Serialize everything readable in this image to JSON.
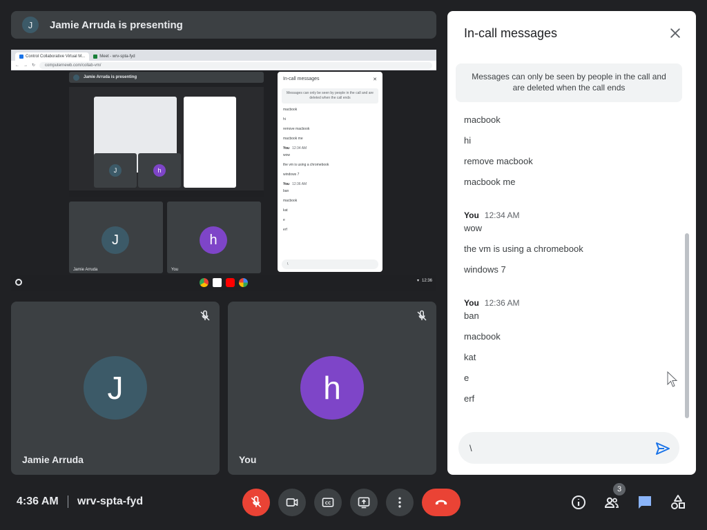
{
  "presenting": {
    "initial": "J",
    "text": "Jamie Arruda is presenting"
  },
  "screen": {
    "tab1": "Control Collaborative Virtual M...",
    "tab2": "Meet - wrv-spta-fyd",
    "url": "computernewb.com/collab-vm/",
    "inner_banner": "Jamie Arruda is presenting",
    "inner_chat_title": "In-call messages",
    "inner_note": "Messages can only be seen by people in the call and are deleted when the call ends",
    "inner_msgs": [
      "macbook",
      "hi",
      "remove macbook",
      "macbook me"
    ],
    "inner_you1": "You",
    "inner_time1": "12:34 AM",
    "inner_msgs2": [
      "wow",
      "the vm is using a chromebook",
      "windows 7"
    ],
    "inner_you2": "You",
    "inner_time2": "12:36 AM",
    "inner_msgs3": [
      "ban",
      "macbook",
      "kat",
      "e",
      "erf"
    ],
    "inner_input": "\\",
    "inner_names": [
      "Jamie Arruda",
      "You"
    ],
    "inner_initials": [
      "J",
      "h"
    ],
    "shelf_time": "12:36"
  },
  "tiles": [
    {
      "name": "Jamie Arruda",
      "initial": "J",
      "color": "#3c5a68"
    },
    {
      "name": "You",
      "initial": "h",
      "color": "#7e45c8"
    }
  ],
  "chat": {
    "title": "In-call messages",
    "note": "Messages can only be seen by people in the call and are deleted when the call ends",
    "messages": [
      {
        "text": "macbook"
      },
      {
        "text": "hi"
      },
      {
        "text": "remove macbook"
      },
      {
        "text": "macbook me"
      }
    ],
    "group1": {
      "sender": "You",
      "time": "12:34 AM",
      "messages": [
        "wow",
        "the  vm is using a chromebook",
        "windows 7"
      ]
    },
    "group2": {
      "sender": "You",
      "time": "12:36 AM",
      "messages": [
        "ban",
        "macbook",
        "kat",
        "e",
        "erf"
      ]
    },
    "input_value": "\\"
  },
  "bottom": {
    "time": "4:36 AM",
    "meeting_code": "wrv-spta-fyd",
    "participant_count": "3"
  },
  "colors": {
    "mic_off": "#ea4335",
    "end_call": "#ea4335",
    "chat_active": "#8ab4f8",
    "send": "#1a73e8"
  }
}
